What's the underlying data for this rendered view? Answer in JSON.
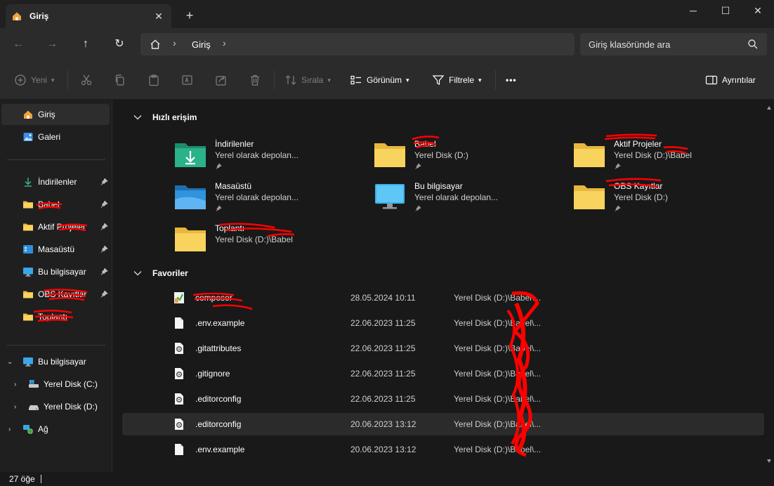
{
  "window": {
    "tab_title": "Giriş",
    "tab_icon": "home-icon",
    "minimize": "─",
    "maximize": "☐",
    "close": "✕",
    "tab_close": "✕",
    "new_tab": "+"
  },
  "nav": {
    "back": "←",
    "forward": "→",
    "up": "↑",
    "refresh": "↻",
    "breadcrumb": "Giriş",
    "separator": "›",
    "search_placeholder": "Giriş klasöründe ara"
  },
  "toolbar": {
    "new_label": "Yeni",
    "sort_label": "Sırala",
    "view_label": "Görünüm",
    "filter_label": "Filtrele",
    "more_label": "•••",
    "details_label": "Ayrıntılar"
  },
  "sidebar": {
    "home": "Giriş",
    "gallery": "Galeri",
    "pinned": [
      {
        "label": "İndirilenler",
        "icon": "download-icon"
      },
      {
        "label": "Babel",
        "icon": "folder-icon"
      },
      {
        "label": "Aktif Projeler",
        "icon": "folder-icon"
      },
      {
        "label": "Masaüstü",
        "icon": "desktop-icon"
      },
      {
        "label": "Bu bilgisayar",
        "icon": "computer-icon"
      },
      {
        "label": "OBS Kayıtlar",
        "icon": "folder-icon"
      },
      {
        "label": "Toplantı",
        "icon": "folder-icon"
      }
    ],
    "this_pc": "Bu bilgisayar",
    "drive_c": "Yerel Disk (C:)",
    "drive_d": "Yerel Disk (D:)",
    "network": "Ağ"
  },
  "quick_access": {
    "title": "Hızlı erişim",
    "items": [
      {
        "name": "İndirilenler",
        "sub": "Yerel olarak depolan...",
        "icon": "downloads-folder-icon"
      },
      {
        "name": "Babel",
        "sub": "Yerel Disk (D:)",
        "icon": "folder-icon"
      },
      {
        "name": "Aktif Projeler",
        "sub": "Yerel Disk (D:)\\Babel",
        "icon": "folder-icon"
      },
      {
        "name": "Masaüstü",
        "sub": "Yerel olarak depolan...",
        "icon": "desktop-folder-icon"
      },
      {
        "name": "Bu bilgisayar",
        "sub": "Yerel olarak depolan...",
        "icon": "monitor-icon"
      },
      {
        "name": "OBS Kayıtlar",
        "sub": "Yerel Disk (D:)",
        "icon": "folder-icon"
      },
      {
        "name": "Toplantı",
        "sub": "Yerel Disk (D:)\\Babel",
        "icon": "folder-icon"
      }
    ]
  },
  "favorites": {
    "title": "Favoriler",
    "rows": [
      {
        "name": "composer",
        "date": "28.05.2024 10:11",
        "path": "Yerel Disk (D:)\\Babel\\...",
        "icon": "composer-file-icon"
      },
      {
        "name": ".env.example",
        "date": "22.06.2023 11:25",
        "path": "Yerel Disk (D:)\\Babel\\...",
        "icon": "file-icon"
      },
      {
        "name": ".gitattributes",
        "date": "22.06.2023 11:25",
        "path": "Yerel Disk (D:)\\Babel\\...",
        "icon": "settings-file-icon"
      },
      {
        "name": ".gitignore",
        "date": "22.06.2023 11:25",
        "path": "Yerel Disk (D:)\\Babel\\...",
        "icon": "settings-file-icon"
      },
      {
        "name": ".editorconfig",
        "date": "22.06.2023 11:25",
        "path": "Yerel Disk (D:)\\Babel\\...",
        "icon": "settings-file-icon"
      },
      {
        "name": ".editorconfig",
        "date": "20.06.2023 13:12",
        "path": "Yerel Disk (D:)\\Babel\\...",
        "icon": "settings-file-icon"
      },
      {
        "name": ".env.example",
        "date": "20.06.2023 13:12",
        "path": "Yerel Disk (D:)\\Babel\\...",
        "icon": "file-icon"
      }
    ]
  },
  "status": {
    "count": "27 öğe"
  },
  "colors": {
    "folder": "#f3c94e",
    "accent": "#4aa3e8",
    "redaction": "#ff0000"
  }
}
